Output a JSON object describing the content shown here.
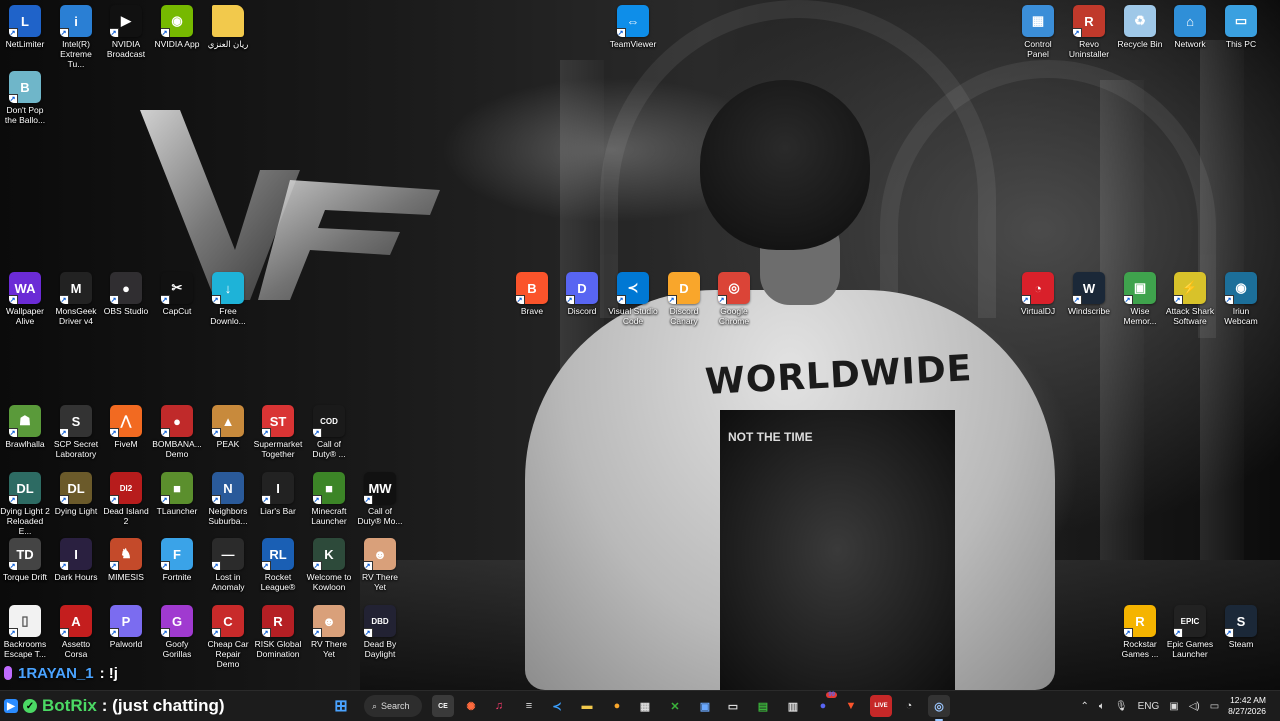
{
  "desktop": {
    "icons": [
      {
        "name": "netlimiter",
        "label": "NetLimiter",
        "glyph": "L",
        "color": "#1f63c9"
      },
      {
        "name": "intel-extreme-tuning",
        "label": "Intel(R) Extreme Tu...",
        "glyph": "i",
        "color": "#2a7fd4"
      },
      {
        "name": "nvidia-broadcast",
        "label": "NVIDIA Broadcast",
        "glyph": "▶",
        "color": "#111111"
      },
      {
        "name": "nvidia-app",
        "label": "NVIDIA App",
        "glyph": "◉",
        "color": "#76b900"
      },
      {
        "name": "folder-rayan",
        "label": "ريان العنزي",
        "glyph": "",
        "color": "#f2c94c"
      },
      {
        "name": "dont-pop-balloon",
        "label": "Don't Pop the Ballo...",
        "glyph": "B",
        "color": "#6fb6c9"
      },
      {
        "name": "teamviewer",
        "label": "TeamViewer",
        "glyph": "⇔",
        "color": "#0e8ee9"
      },
      {
        "name": "control-panel",
        "label": "Control Panel",
        "glyph": "▦",
        "color": "#3b8ed8"
      },
      {
        "name": "revo-uninstaller",
        "label": "Revo Uninstaller",
        "glyph": "R",
        "color": "#c0392b"
      },
      {
        "name": "recycle-bin",
        "label": "Recycle Bin",
        "glyph": "♻",
        "color": "#9fc8e8"
      },
      {
        "name": "network",
        "label": "Network",
        "glyph": "⌂",
        "color": "#2f8fd8"
      },
      {
        "name": "this-pc",
        "label": "This PC",
        "glyph": "▭",
        "color": "#3aa0e0"
      },
      {
        "name": "wallpaper-alive",
        "label": "Wallpaper Alive",
        "glyph": "WA",
        "color": "#6b2bd6"
      },
      {
        "name": "monsgeek-driver",
        "label": "MonsGeek Driver v4",
        "glyph": "M",
        "color": "#222222"
      },
      {
        "name": "obs-studio",
        "label": "OBS Studio",
        "glyph": "●",
        "color": "#302e31"
      },
      {
        "name": "capcut",
        "label": "CapCut",
        "glyph": "✂",
        "color": "#111111"
      },
      {
        "name": "free-download",
        "label": "Free Downlo...",
        "glyph": "↓",
        "color": "#1eb3d8"
      },
      {
        "name": "brave",
        "label": "Brave",
        "glyph": "B",
        "color": "#fb542b"
      },
      {
        "name": "discord",
        "label": "Discord",
        "glyph": "D",
        "color": "#5865f2"
      },
      {
        "name": "vscode",
        "label": "Visual Studio Code",
        "glyph": "≺",
        "color": "#0078d4"
      },
      {
        "name": "discord-canary",
        "label": "Discord Canary",
        "glyph": "D",
        "color": "#f9a62b"
      },
      {
        "name": "google-chrome",
        "label": "Google Chrome",
        "glyph": "◎",
        "color": "#db4437"
      },
      {
        "name": "virtualdj",
        "label": "VirtualDJ",
        "glyph": "◔",
        "color": "#d9202a"
      },
      {
        "name": "windscribe",
        "label": "Windscribe",
        "glyph": "W",
        "color": "#1b2838"
      },
      {
        "name": "wise-memory",
        "label": "Wise Memor...",
        "glyph": "▣",
        "color": "#3fa34d"
      },
      {
        "name": "attack-shark",
        "label": "Attack Shark Software",
        "glyph": "⚡",
        "color": "#d8c22a"
      },
      {
        "name": "iriun-webcam",
        "label": "Iriun Webcam",
        "glyph": "◉",
        "color": "#1c6f9a"
      },
      {
        "name": "brawlhalla",
        "label": "Brawlhalla",
        "glyph": "☗",
        "color": "#5a9a3a"
      },
      {
        "name": "scp-secret-lab",
        "label": "SCP Secret Laboratory",
        "glyph": "S",
        "color": "#333333"
      },
      {
        "name": "fivem",
        "label": "FiveM",
        "glyph": "⋀",
        "color": "#f26a21"
      },
      {
        "name": "bombanauts",
        "label": "BOMBANA... Demo",
        "glyph": "●",
        "color": "#c02a2a"
      },
      {
        "name": "peak",
        "label": "PEAK",
        "glyph": "▲",
        "color": "#c88a3c"
      },
      {
        "name": "supermarket-together",
        "label": "Supermarket Together",
        "glyph": "ST",
        "color": "#d93434"
      },
      {
        "name": "call-of-duty-1",
        "label": "Call of Duty® ...",
        "glyph": "COD",
        "color": "#1a1a1a"
      },
      {
        "name": "dying-light-2",
        "label": "Dying Light 2 Reloaded E...",
        "glyph": "DL",
        "color": "#2d6b63"
      },
      {
        "name": "dying-light",
        "label": "Dying Light",
        "glyph": "DL",
        "color": "#6b5a2a"
      },
      {
        "name": "dead-island-2",
        "label": "Dead Island 2",
        "glyph": "DI2",
        "color": "#b71c1c"
      },
      {
        "name": "tlauncher",
        "label": "TLauncher",
        "glyph": "■",
        "color": "#5b8f2d"
      },
      {
        "name": "neighbors-suburban",
        "label": "Neighbors Suburba...",
        "glyph": "N",
        "color": "#2a5a9a"
      },
      {
        "name": "liars-bar",
        "label": "Liar's Bar",
        "glyph": "I",
        "color": "#222222"
      },
      {
        "name": "minecraft-launcher",
        "label": "Minecraft Launcher",
        "glyph": "■",
        "color": "#3c8527"
      },
      {
        "name": "call-of-duty-mw",
        "label": "Call of Duty® Mo...",
        "glyph": "MW",
        "color": "#111111"
      },
      {
        "name": "torque-drift",
        "label": "Torque Drift",
        "glyph": "TD",
        "color": "#444444"
      },
      {
        "name": "dark-hours",
        "label": "Dark Hours",
        "glyph": "I",
        "color": "#2a2040"
      },
      {
        "name": "mimesis",
        "label": "MIMESIS",
        "glyph": "♞",
        "color": "#c44a2a"
      },
      {
        "name": "fortnite",
        "label": "Fortnite",
        "glyph": "F",
        "color": "#3aa3e8"
      },
      {
        "name": "lost-in-anomaly",
        "label": "Lost in Anomaly",
        "glyph": "—",
        "color": "#2b2b2b"
      },
      {
        "name": "rocket-league",
        "label": "Rocket League®",
        "glyph": "RL",
        "color": "#1a5fb4"
      },
      {
        "name": "welcome-to-kowloon",
        "label": "Welcome to Kowloon",
        "glyph": "K",
        "color": "#2d4a3a"
      },
      {
        "name": "rv-there-yet-1",
        "label": "RV There Yet",
        "glyph": "☻",
        "color": "#d9a07a"
      },
      {
        "name": "backrooms-escape",
        "label": "Backrooms Escape T...",
        "glyph": "▯",
        "color": "#f2f2f2"
      },
      {
        "name": "assetto-corsa",
        "label": "Assetto Corsa",
        "glyph": "A",
        "color": "#c41e1e"
      },
      {
        "name": "palworld",
        "label": "Palworld",
        "glyph": "P",
        "color": "#7b6cf0"
      },
      {
        "name": "goofy-gorillas",
        "label": "Goofy Gorillas",
        "glyph": "G",
        "color": "#a03ad0"
      },
      {
        "name": "cheap-car-repair",
        "label": "Cheap Car Repair Demo",
        "glyph": "C",
        "color": "#c82a2a"
      },
      {
        "name": "risk-global-domination",
        "label": "RISK Global Domination",
        "glyph": "R",
        "color": "#b51f24"
      },
      {
        "name": "rv-there-yet-2",
        "label": "RV There Yet",
        "glyph": "☻",
        "color": "#d9a07a"
      },
      {
        "name": "dead-by-daylight",
        "label": "Dead By Daylight",
        "glyph": "DBD",
        "color": "#222233"
      },
      {
        "name": "rockstar-games",
        "label": "Rockstar Games ...",
        "glyph": "R",
        "color": "#f5b400"
      },
      {
        "name": "epic-games",
        "label": "Epic Games Launcher",
        "glyph": "EPIC",
        "color": "#222222"
      },
      {
        "name": "steam",
        "label": "Steam",
        "glyph": "S",
        "color": "#1b2838"
      }
    ]
  },
  "wallpaper": {
    "logo_text": "VF",
    "shirt_text": "WORLDWIDE",
    "shirt_subtext": "NOT THE TIME"
  },
  "chat": {
    "username": "1RAYAN_1",
    "message": ": !j"
  },
  "taskbar": {
    "overlay_brand": "BotRix",
    "overlay_text": ": (just chatting)",
    "search_label": "Search",
    "language": "ENG",
    "time": "12:42 AM",
    "date": "8/27/2026",
    "discord_badge": "99"
  }
}
